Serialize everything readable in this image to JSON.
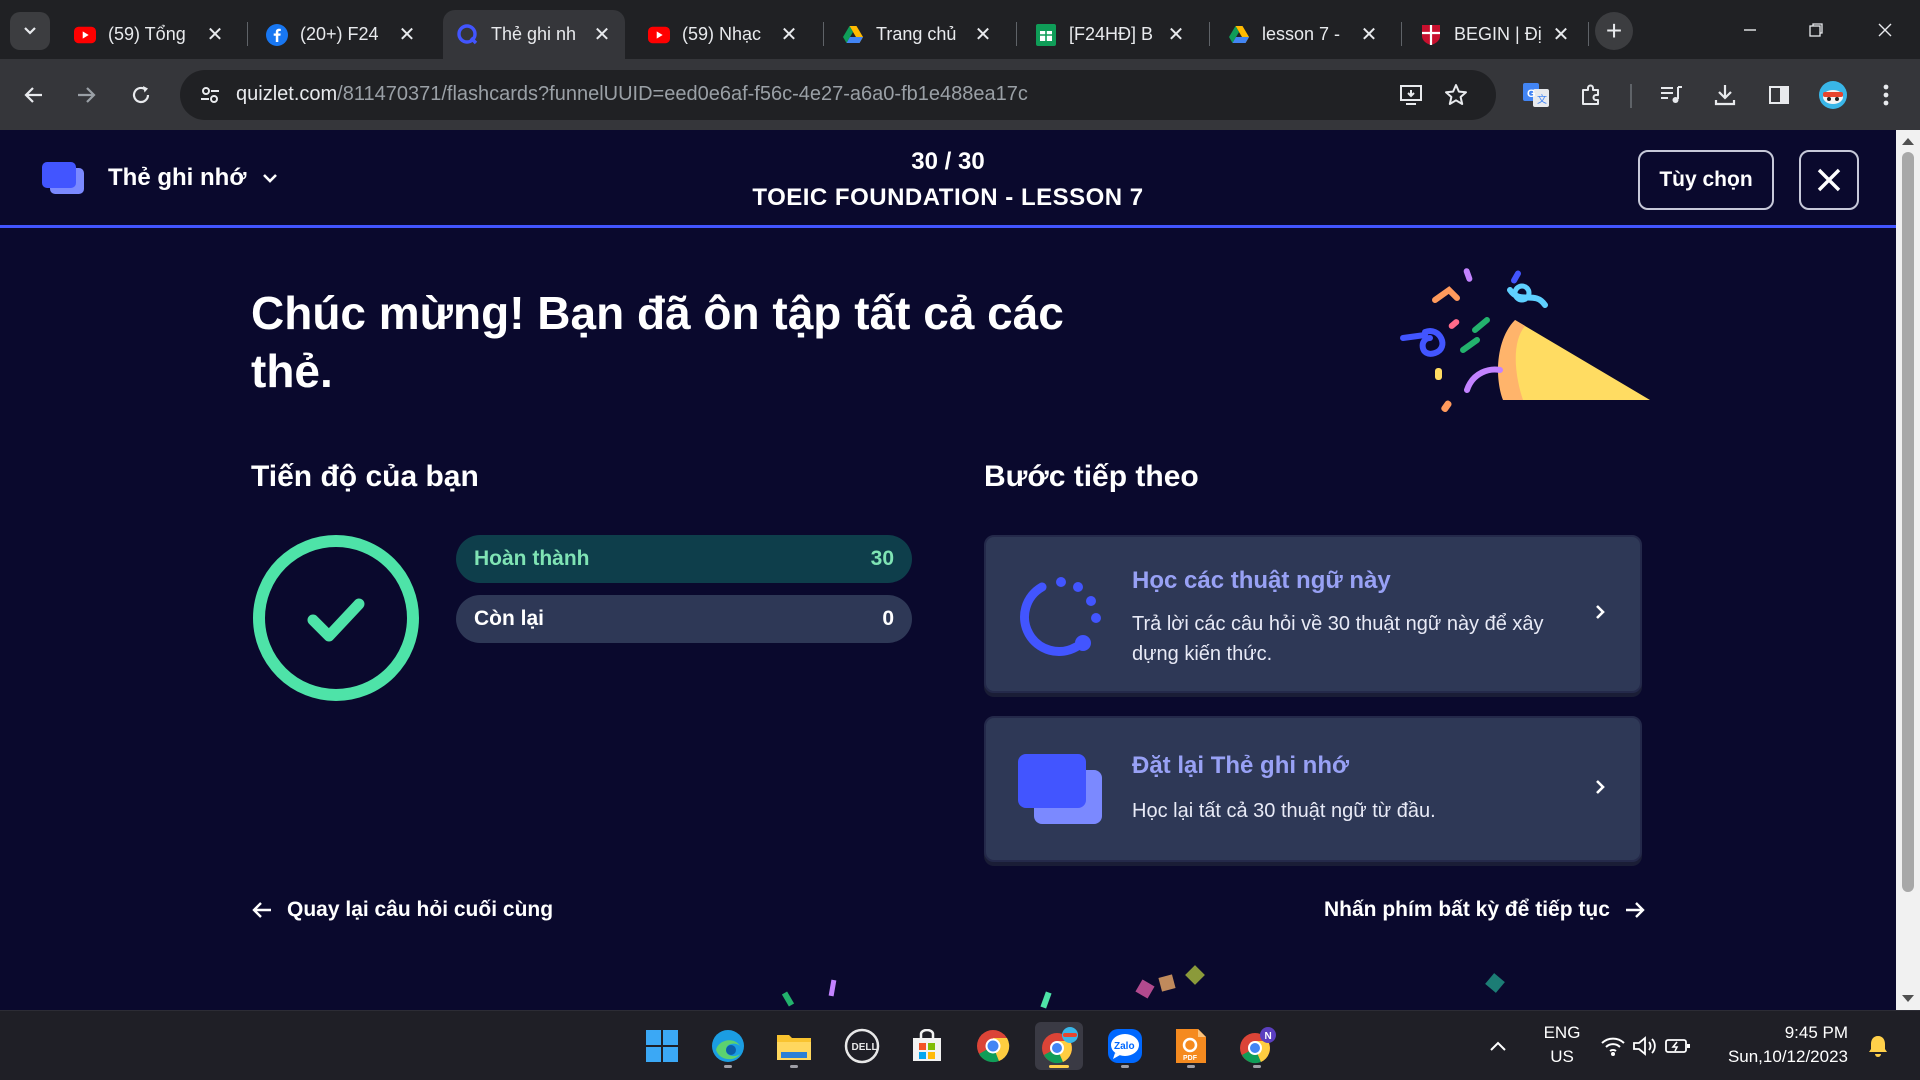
{
  "browser": {
    "tabs": [
      {
        "title": "(59) Tổng",
        "icon": "youtube-icon"
      },
      {
        "title": "(20+) F24",
        "icon": "facebook-icon"
      },
      {
        "title": "Thẻ ghi nh",
        "icon": "quizlet-icon",
        "active": true
      },
      {
        "title": "(59) Nhạc",
        "icon": "youtube-icon"
      },
      {
        "title": "Trang chủ",
        "icon": "google-drive-icon"
      },
      {
        "title": "[F24HĐ] B",
        "icon": "google-sheets-icon"
      },
      {
        "title": "lesson 7 -",
        "icon": "google-drive-icon"
      },
      {
        "title": "BEGIN | Đị",
        "icon": "cambridge-icon"
      }
    ],
    "url_host": "quizlet.com",
    "url_path": "/811470371/flashcards?funnelUUID=eed0e6af-f56c-4e27-a6a0-fb1e488ea17c"
  },
  "header": {
    "mode_label": "Thẻ ghi nhớ",
    "counter": "30 / 30",
    "set_title": "TOEIC FOUNDATION - LESSON 7",
    "options_label": "Tùy chọn"
  },
  "main": {
    "congrats_title": "Chúc mừng! Bạn đã ôn tập tất cả các thẻ.",
    "progress": {
      "title": "Tiến độ của bạn",
      "completed_label": "Hoàn thành",
      "completed_value": "30",
      "remaining_label": "Còn lại",
      "remaining_value": "0"
    },
    "next_steps": {
      "title": "Bước tiếp theo",
      "study": {
        "title": "Học các thuật ngữ này",
        "desc": "Trả lời các câu hỏi về 30 thuật ngữ này để xây dựng kiến thức."
      },
      "reset": {
        "title": "Đặt lại Thẻ ghi nhớ",
        "desc": "Học lại tất cả 30 thuật ngữ từ đầu."
      }
    },
    "back_link": "Quay lại câu hỏi cuối cùng",
    "continue_link": "Nhấn phím bất kỳ để tiếp tục"
  },
  "colors": {
    "page_bg": "#0a092d",
    "accent": "#4255ff",
    "success": "#4ee3a8",
    "card_bg": "#2e3856",
    "link_color": "#98a1f5"
  },
  "taskbar": {
    "apps": [
      "start-icon",
      "edge-icon",
      "file-explorer-icon",
      "dell-icon",
      "microsoft-store-icon",
      "chrome-icon",
      "chrome-profile-icon",
      "zalo-icon",
      "pdf-reader-icon",
      "chrome-n-icon"
    ],
    "zalo_label": "Zalo",
    "pdf_label": "PDF",
    "chrome_badge": "N",
    "lang_top": "ENG",
    "lang_bottom": "US",
    "time": "9:45 PM",
    "date": "Sun,10/12/2023"
  }
}
